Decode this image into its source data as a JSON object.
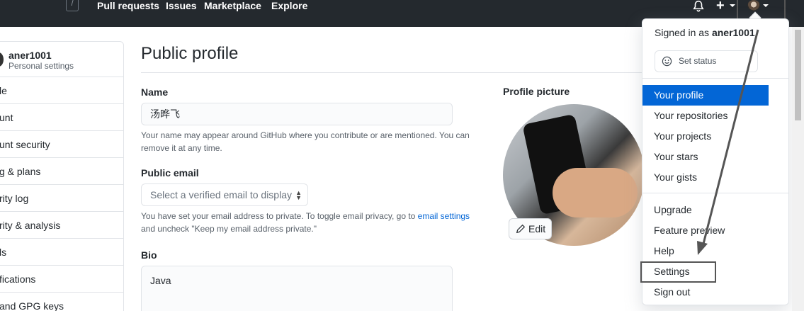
{
  "header": {
    "slash_key": "/",
    "nav": [
      "Pull requests",
      "Issues",
      "Marketplace",
      "Explore"
    ],
    "icons": {
      "notifications": "bell-icon",
      "create": "plus-icon",
      "avatar": "user-avatar"
    }
  },
  "sidebar": {
    "username": "aner1001",
    "subtitle": "Personal settings",
    "items": [
      "le",
      "unt",
      "unt security",
      "g & plans",
      "rity log",
      "rity & analysis",
      "ls",
      "fications",
      "and GPG keys"
    ]
  },
  "main": {
    "title": "Public profile",
    "name": {
      "label": "Name",
      "value": "汤晔飞",
      "note": "Your name may appear around GitHub where you contribute or are mentioned. You can remove it at any time."
    },
    "email": {
      "label": "Public email",
      "placeholder": "Select a verified email to display",
      "note_before": "You have set your email address to private. To toggle email privacy, go to ",
      "note_link": "email settings",
      "note_after": " and uncheck \"Keep my email address private.\""
    },
    "bio": {
      "label": "Bio",
      "value": "Java"
    },
    "picture": {
      "label": "Profile picture",
      "edit_label": "Edit"
    }
  },
  "dropdown": {
    "signed_in_prefix": "Signed in as ",
    "signed_in_user": "aner1001",
    "set_status": "Set status",
    "group1": [
      "Your profile",
      "Your repositories",
      "Your projects",
      "Your stars",
      "Your gists"
    ],
    "group2": [
      "Upgrade",
      "Feature preview",
      "Help",
      "Settings"
    ],
    "sign_out": "Sign out"
  },
  "colors": {
    "header_bg": "#24292e",
    "accent": "#0366d6",
    "annotation": "#555555"
  }
}
